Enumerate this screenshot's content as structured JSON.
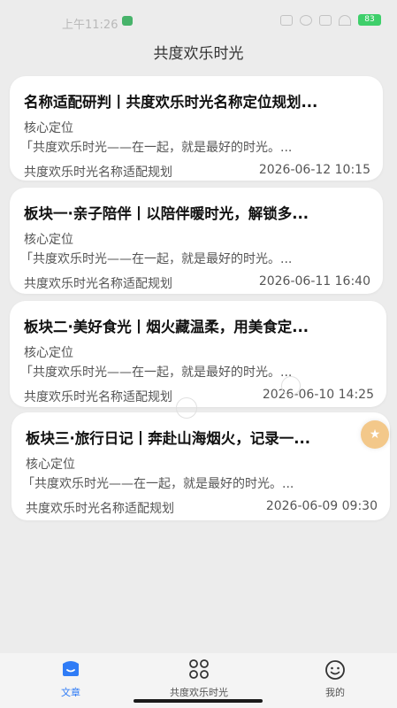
{
  "status_bar": {
    "time": "上午11:26",
    "battery": "83"
  },
  "header": {
    "title": "共度欢乐时光"
  },
  "articles": [
    {
      "title": "名称适配研判丨共度欢乐时光名称定位规划...",
      "label": "核心定位",
      "excerpt": "「共度欢乐时光——在一起，就是最好的时光。...",
      "source": "共度欢乐时光名称适配规划",
      "time": "2026-06-12 10:15"
    },
    {
      "title": "板块一·亲子陪伴丨以陪伴暖时光，解锁多...",
      "label": "核心定位",
      "excerpt": "「共度欢乐时光——在一起，就是最好的时光。...",
      "source": "共度欢乐时光名称适配规划",
      "time": "2026-06-11 16:40"
    },
    {
      "title": "板块二·美好食光丨烟火藏温柔，用美食定...",
      "label": "核心定位",
      "excerpt": "「共度欢乐时光——在一起，就是最好的时光。...",
      "source": "共度欢乐时光名称适配规划",
      "time": "2026-06-10 14:25"
    },
    {
      "title": "板块三·旅行日记丨奔赴山海烟火，记录一...",
      "label": "核心定位",
      "excerpt": "「共度欢乐时光——在一起，就是最好的时光。...",
      "source": "共度欢乐时光名称适配规划",
      "time": "2026-06-09 09:30"
    }
  ],
  "tabbar": {
    "items": [
      {
        "label": "文章",
        "icon": "article-icon",
        "active": true
      },
      {
        "label": "共度欢乐时光",
        "icon": "grid-apps-icon",
        "active": false
      },
      {
        "label": "我的",
        "icon": "smiley-profile-icon",
        "active": false
      }
    ]
  },
  "colors": {
    "accent": "#2f7cf6",
    "background": "#ececec",
    "card": "#ffffff",
    "float_button": "#f3c88a",
    "battery": "#3ecf6a"
  }
}
